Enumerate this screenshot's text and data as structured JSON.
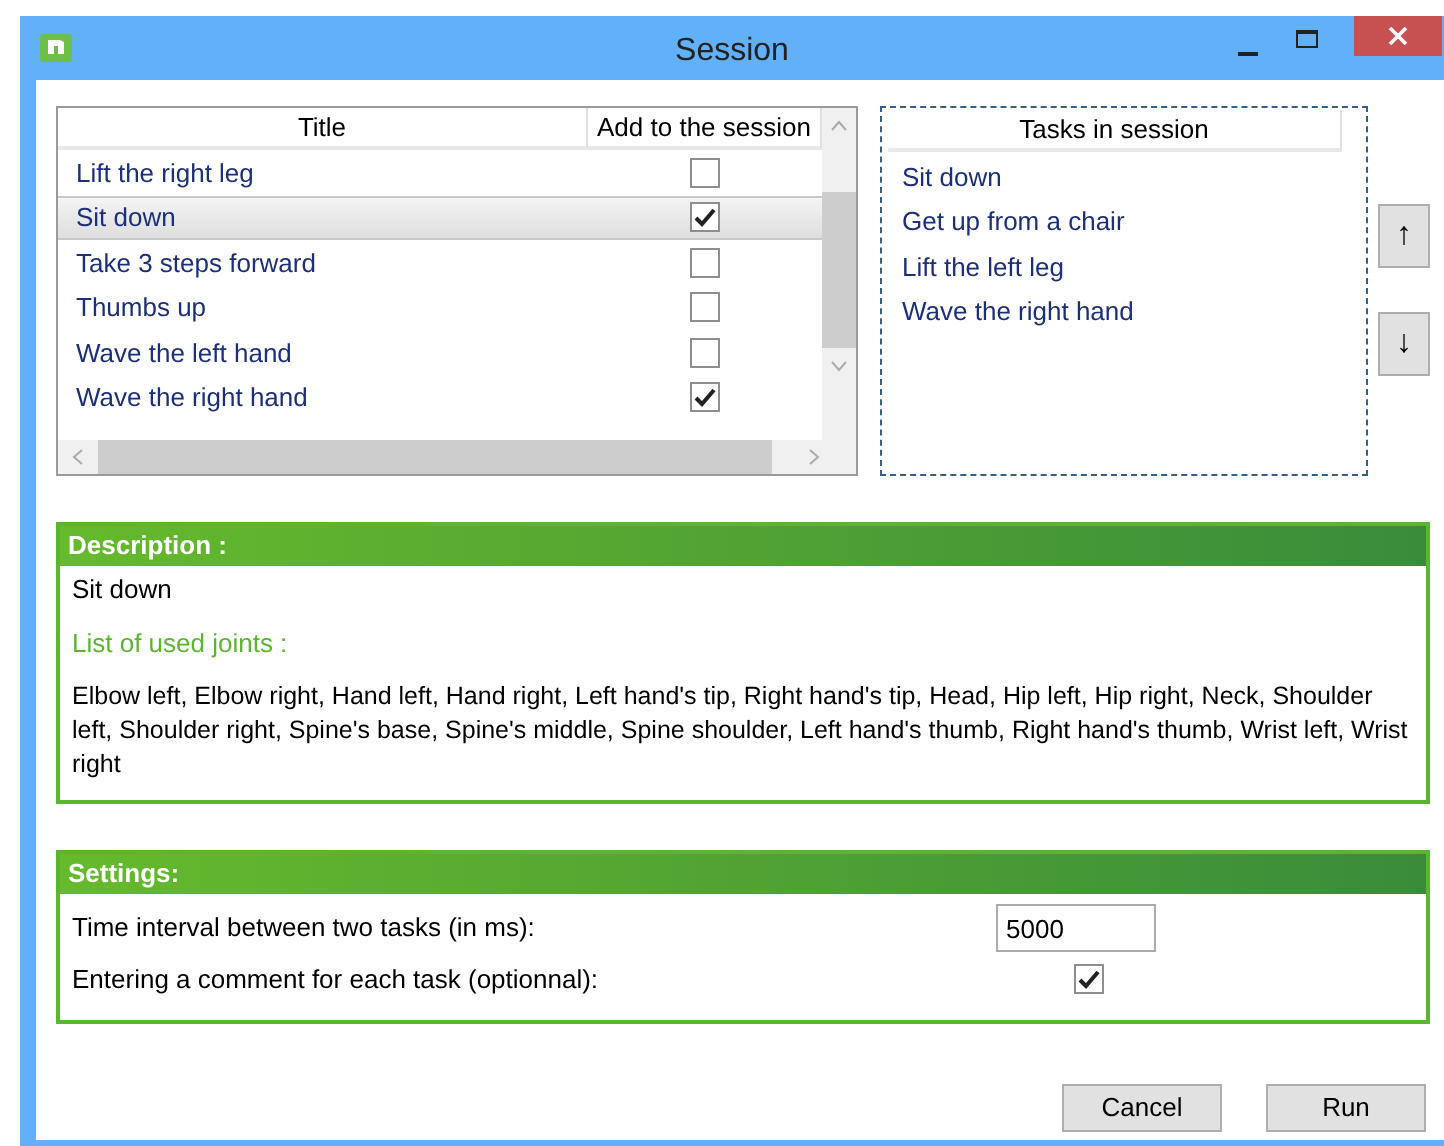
{
  "window": {
    "title": "Session"
  },
  "exercises": {
    "columns": [
      "Title",
      "Add to the session"
    ],
    "rows": [
      {
        "title": "Lift the right leg",
        "checked": false,
        "selected": false
      },
      {
        "title": "Sit down",
        "checked": true,
        "selected": true
      },
      {
        "title": "Take 3 steps forward",
        "checked": false,
        "selected": false
      },
      {
        "title": "Thumbs up",
        "checked": false,
        "selected": false
      },
      {
        "title": "Wave the left hand",
        "checked": false,
        "selected": false
      },
      {
        "title": "Wave the right hand",
        "checked": true,
        "selected": false
      }
    ]
  },
  "session_tasks": {
    "header": "Tasks in session",
    "items": [
      "Sit down",
      "Get up from a chair",
      "Lift the left leg",
      "Wave the right hand"
    ]
  },
  "move_buttons": [
    "↑",
    "↓"
  ],
  "description": {
    "header": "Description :",
    "name": "Sit down",
    "joints_label": "List of used joints :",
    "joints": "Elbow left, Elbow right, Hand left, Hand right, Left hand's tip, Right hand's tip, Head, Hip left, Hip right, Neck, Shoulder left, Shoulder right, Spine's base, Spine's middle, Spine shoulder, Left hand's thumb, Right hand's thumb, Wrist left, Wrist right"
  },
  "settings": {
    "header": "Settings:",
    "interval_label": "Time interval between two tasks (in ms):",
    "interval_value": "5000",
    "comment_label": "Entering a comment for each task (optionnal):",
    "comment_checked": true
  },
  "buttons": [
    "Cancel",
    "Run"
  ]
}
